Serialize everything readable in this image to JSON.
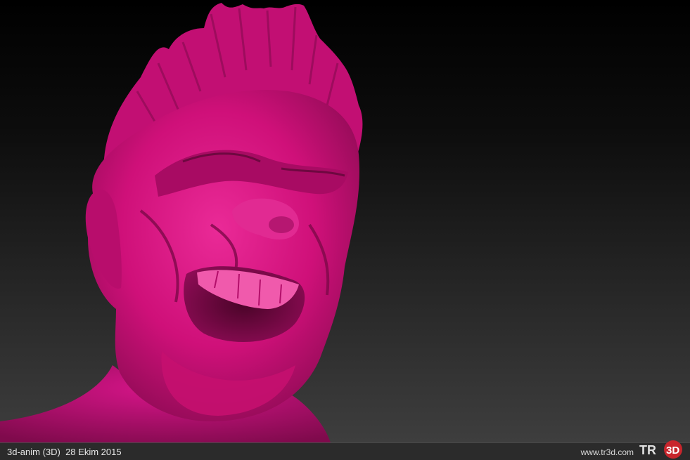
{
  "footer": {
    "caption": "3d-anim (3D)  28 Ekim 2015",
    "site": "www.tr3d.com",
    "logo_text": "TR3D"
  },
  "image": {
    "subject": "pink-clay-sculpted-screaming-face",
    "colors": {
      "skin": "#d1127e",
      "skin_shadow": "#7a0a4a",
      "background_top": "#000000",
      "background_bottom": "#3e3e3e",
      "footer": "#2b2b2b",
      "logo_accent": "#c8252c"
    }
  }
}
